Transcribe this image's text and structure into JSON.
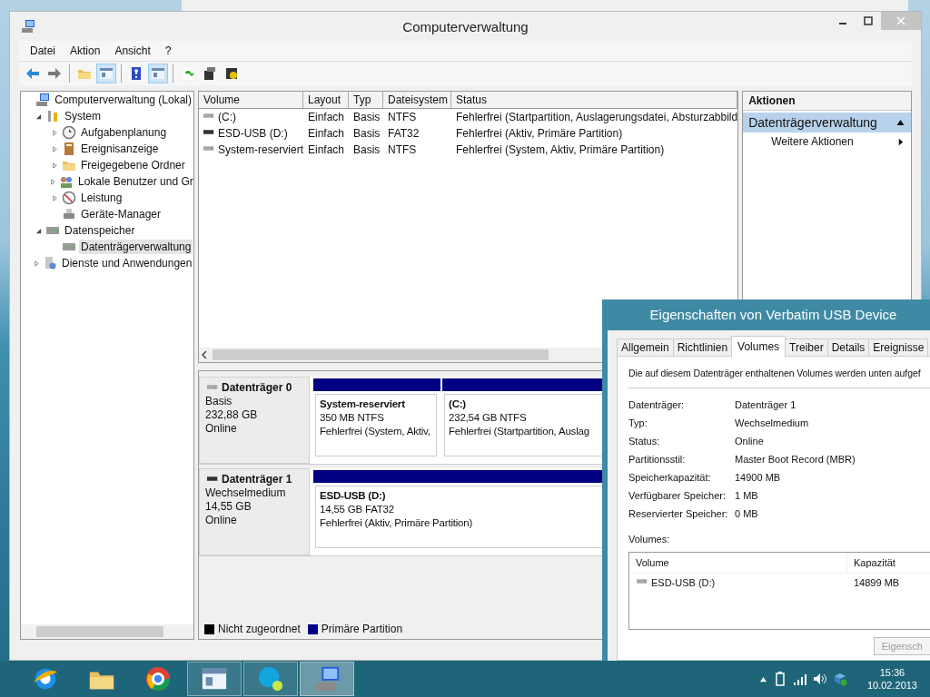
{
  "main_window": {
    "title": "Computerverwaltung",
    "menu": [
      "Datei",
      "Aktion",
      "Ansicht",
      "?"
    ],
    "toolbar": [
      {
        "kind": "back",
        "selected": false
      },
      {
        "kind": "forward",
        "selected": false
      },
      {
        "kind": "sep"
      },
      {
        "kind": "up",
        "selected": false
      },
      {
        "kind": "tree",
        "selected": true
      },
      {
        "kind": "sep"
      },
      {
        "kind": "help",
        "selected": false
      },
      {
        "kind": "panel",
        "selected": true
      },
      {
        "kind": "sep"
      },
      {
        "kind": "export",
        "selected": false
      },
      {
        "kind": "properties",
        "selected": false
      },
      {
        "kind": "settings",
        "selected": false
      }
    ],
    "tree": [
      {
        "label": "Computerverwaltung (Lokal)",
        "selected": false,
        "children": [
          {
            "label": "System",
            "selected": false,
            "expanded": true,
            "children": [
              {
                "label": "Aufgabenplanung",
                "selected": false,
                "expanded": false
              },
              {
                "label": "Ereignisanzeige",
                "selected": false,
                "expanded": false
              },
              {
                "label": "Freigegebene Ordner",
                "selected": false,
                "expanded": false
              },
              {
                "label": "Lokale Benutzer und Gr",
                "selected": false,
                "expanded": false
              },
              {
                "label": "Leistung",
                "selected": false,
                "expanded": false
              },
              {
                "label": "Geräte-Manager",
                "selected": false
              }
            ]
          },
          {
            "label": "Datenspeicher",
            "selected": false,
            "expanded": true,
            "children": [
              {
                "label": "Datenträgerverwaltung",
                "selected": true
              }
            ]
          },
          {
            "label": "Dienste und Anwendungen",
            "selected": false,
            "expanded": false
          }
        ]
      }
    ],
    "volume_table": {
      "columns": [
        "Volume",
        "Layout",
        "Typ",
        "Dateisystem",
        "Status"
      ],
      "rows": [
        {
          "kind": "fixed",
          "cells": [
            "(C:)",
            "Einfach",
            "Basis",
            "NTFS",
            "Fehlerfrei (Startpartition, Auslagerungsdatei, Absturzabbild"
          ]
        },
        {
          "kind": "removable",
          "cells": [
            "ESD-USB (D:)",
            "Einfach",
            "Basis",
            "FAT32",
            "Fehlerfrei (Aktiv, Primäre Partition)"
          ]
        },
        {
          "kind": "fixed",
          "cells": [
            "System-reserviert",
            "Einfach",
            "Basis",
            "NTFS",
            "Fehlerfrei (System, Aktiv, Primäre Partition)"
          ]
        }
      ]
    },
    "disks": [
      {
        "name": "Datenträger 0",
        "kind": "fixed",
        "type": "Basis",
        "size": "232,88 GB",
        "status": "Online",
        "partitions": [
          {
            "name": "System-reserviert",
            "size": "350 MB NTFS",
            "status": "Fehlerfrei (System, Aktiv,"
          },
          {
            "name": "(C:)",
            "size": "232,54 GB NTFS",
            "status": "Fehlerfrei (Startpartition, Auslag"
          }
        ]
      },
      {
        "name": "Datenträger 1",
        "kind": "removable",
        "type": "Wechselmedium",
        "size": "14,55 GB",
        "status": "Online",
        "partitions": [
          {
            "name": "ESD-USB (D:)",
            "size": "14,55 GB FAT32",
            "status": "Fehlerfrei (Aktiv, Primäre Partition)"
          }
        ]
      }
    ],
    "legend": [
      {
        "label": "Nicht zugeordnet",
        "color": "#000000"
      },
      {
        "label": "Primäre Partition",
        "color": "#000080"
      }
    ],
    "actions": {
      "heading": "Aktionen",
      "section": "Datenträgerverwaltung",
      "items": [
        "Weitere Aktionen"
      ]
    }
  },
  "dialog": {
    "title": "Eigenschaften von Verbatim USB Device",
    "tabs": [
      {
        "label": "Allgemein",
        "selected": false
      },
      {
        "label": "Richtlinien",
        "selected": false
      },
      {
        "label": "Volumes",
        "selected": true
      },
      {
        "label": "Treiber",
        "selected": false
      },
      {
        "label": "Details",
        "selected": false
      },
      {
        "label": "Ereignisse",
        "selected": false
      }
    ],
    "description": "Die auf diesem Datenträger enthaltenen Volumes werden unten aufgef",
    "properties": [
      {
        "label": "Datenträger:",
        "value": "Datenträger 1"
      },
      {
        "label": "Typ:",
        "value": "Wechselmedium"
      },
      {
        "label": "Status:",
        "value": "Online"
      },
      {
        "label": "Partitionsstil:",
        "value": "Master Boot Record (MBR)"
      },
      {
        "label": "Speicherkapazität:",
        "value": "14900 MB"
      },
      {
        "label": "Verfügbarer Speicher:",
        "value": "1 MB"
      },
      {
        "label": "Reservierter Speicher:",
        "value": "0 MB"
      }
    ],
    "volumes_label": "Volumes:",
    "volumes_columns": [
      "Volume",
      "Kapazität"
    ],
    "volumes_rows": [
      {
        "cells": [
          "ESD-USB (D:)",
          "14899 MB"
        ]
      }
    ],
    "button": {
      "label": "Eigensch",
      "disabled": true
    }
  },
  "taskbar": {
    "apps": [
      {
        "kind": "browser",
        "running": false,
        "active": false
      },
      {
        "kind": "explorer",
        "running": false,
        "active": false
      },
      {
        "kind": "chrome",
        "running": false,
        "active": false
      },
      {
        "kind": "control",
        "running": true,
        "active": false
      },
      {
        "kind": "chat",
        "running": true,
        "active": false
      },
      {
        "kind": "compmgmt",
        "running": true,
        "active": true
      }
    ],
    "time": "15:36",
    "date": "10.02.2013"
  }
}
